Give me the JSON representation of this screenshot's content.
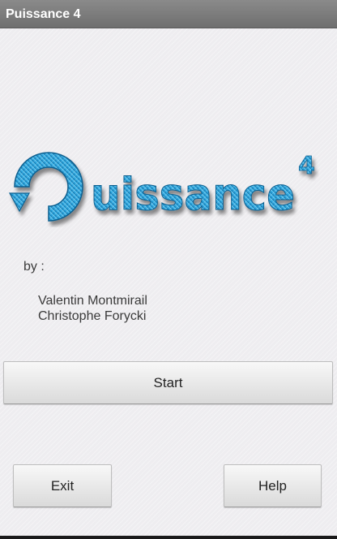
{
  "app": {
    "title": "Puissance 4"
  },
  "logo": {
    "text": "uissance",
    "superscript": "4",
    "colors": {
      "primary": "#1e9ad6",
      "light": "#5bc4ee",
      "dark": "#0c6ea3"
    }
  },
  "credits": {
    "by_label": "by :",
    "authors": [
      "Valentin Montmirail",
      "Christophe Forycki"
    ]
  },
  "buttons": {
    "start_label": "Start",
    "exit_label": "Exit",
    "help_label": "Help"
  },
  "colors": {
    "title_bar": "#7c7c7c",
    "background": "#eeedf0"
  }
}
